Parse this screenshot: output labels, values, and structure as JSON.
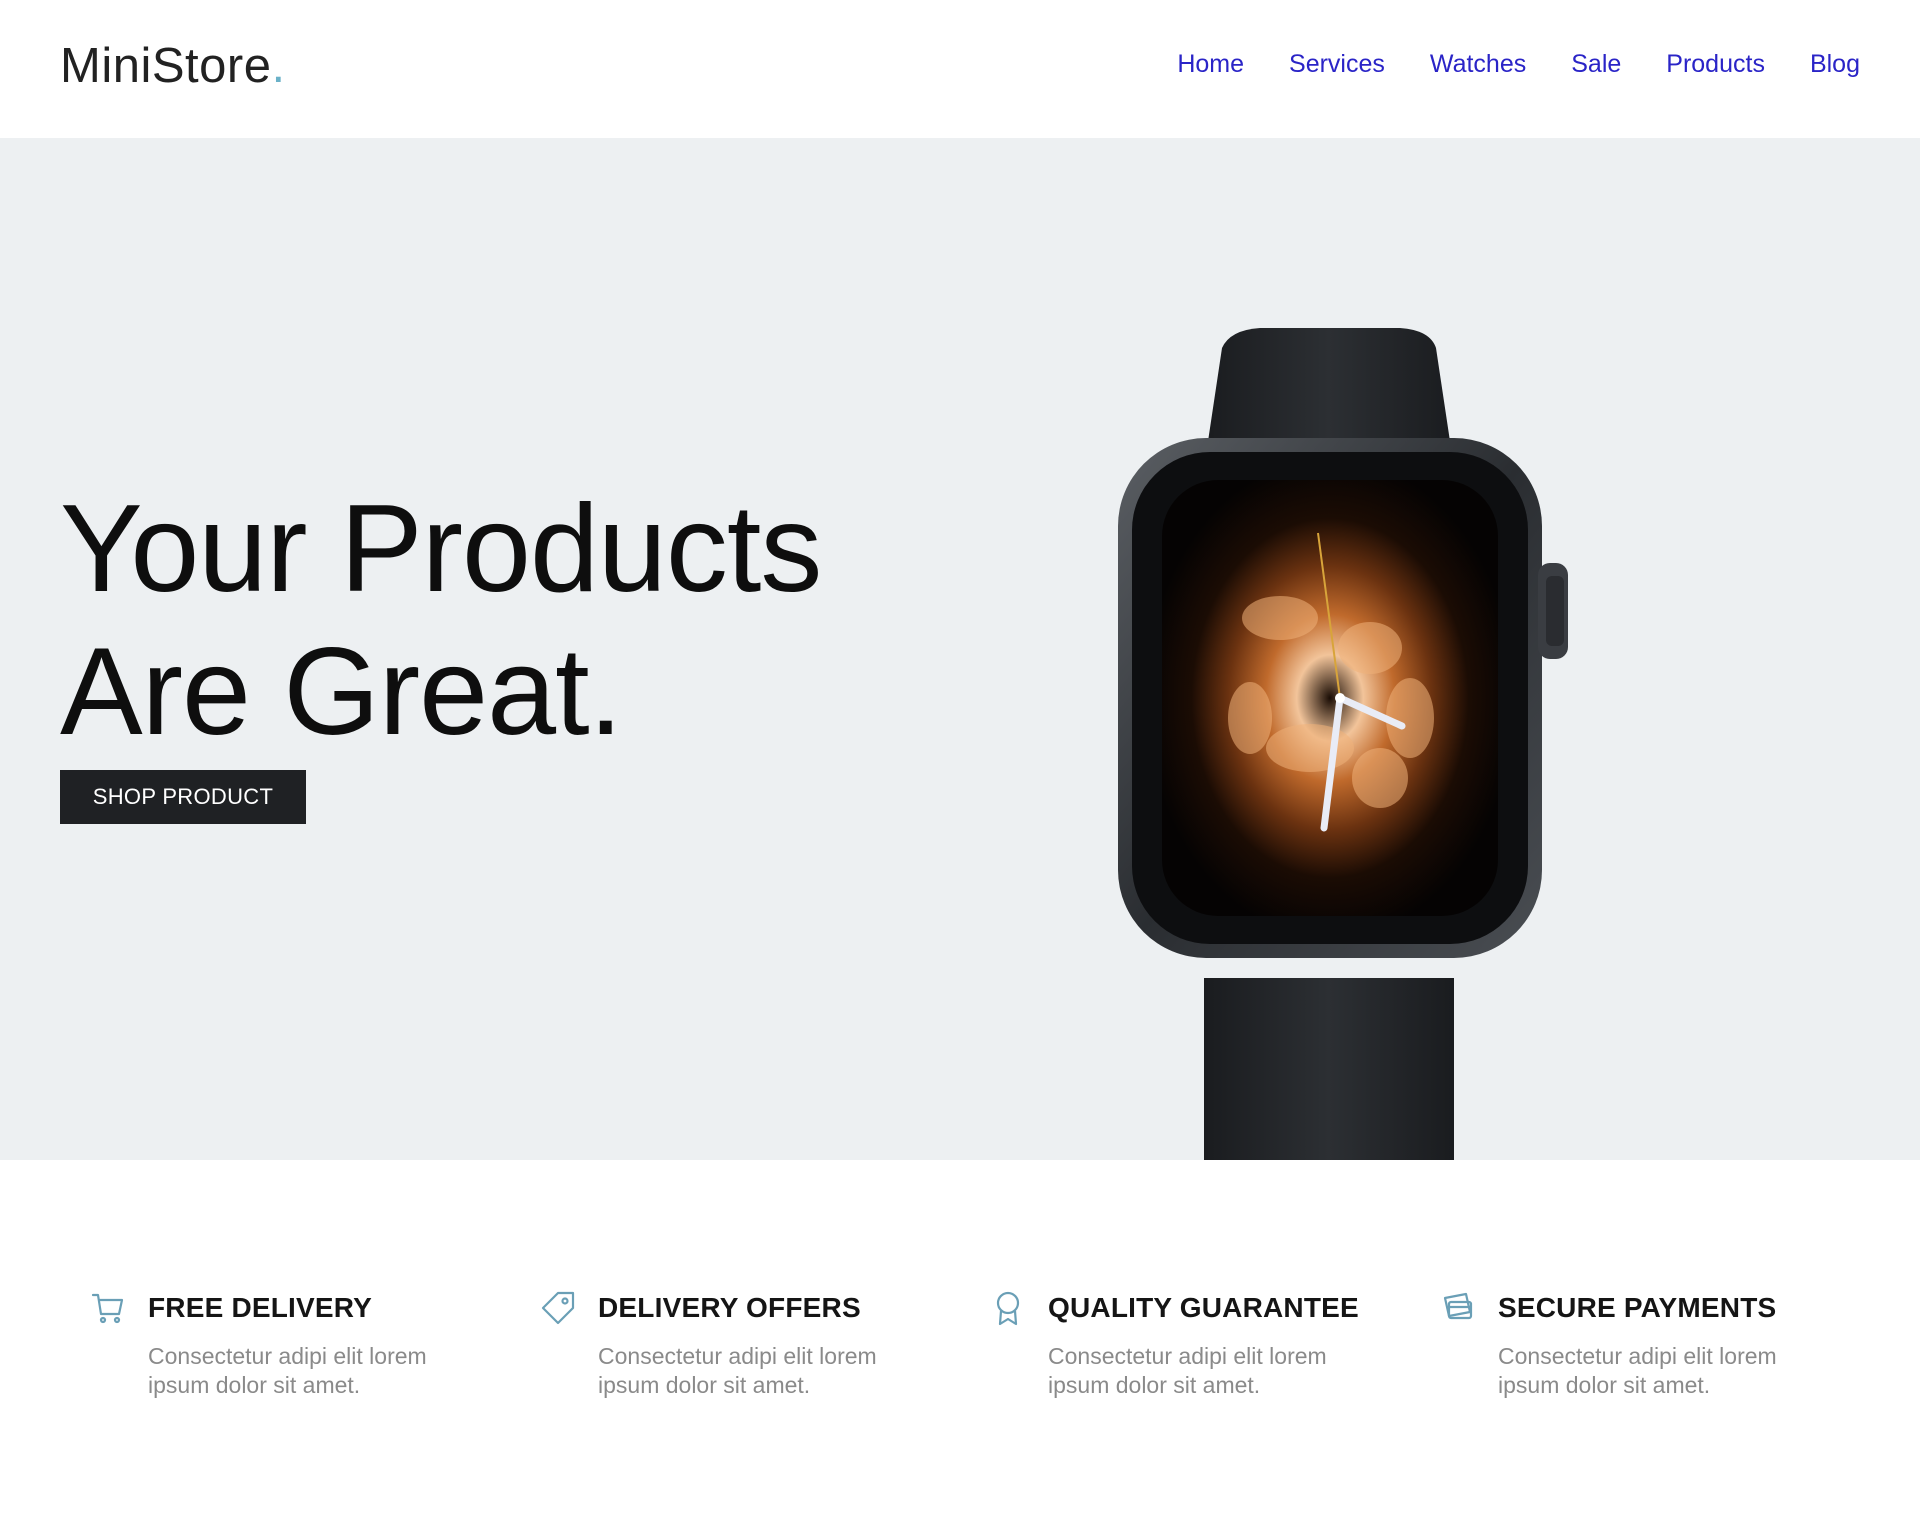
{
  "header": {
    "logo_text": "MiniStore",
    "logo_dot": ".",
    "nav": [
      "Home",
      "Services",
      "Watches",
      "Sale",
      "Products",
      "Blog"
    ]
  },
  "hero": {
    "title_line1": "Your Products",
    "title_line2": "Are Great.",
    "cta_label": "SHOP PRODUCT"
  },
  "features": [
    {
      "icon": "cart-icon",
      "title": "FREE DELIVERY",
      "text": "Consectetur adipi elit lorem ipsum dolor sit amet."
    },
    {
      "icon": "tag-icon",
      "title": "DELIVERY OFFERS",
      "text": "Consectetur adipi elit lorem ipsum dolor sit amet."
    },
    {
      "icon": "award-icon",
      "title": "QUALITY GUARANTEE",
      "text": "Consectetur adipi elit lorem ipsum dolor sit amet."
    },
    {
      "icon": "card-icon",
      "title": "SECURE PAYMENTS",
      "text": "Consectetur adipi elit lorem ipsum dolor sit amet."
    }
  ],
  "colors": {
    "nav_link": "#2a24c7",
    "accent": "#6ab1c8",
    "hero_bg": "#edf0f2",
    "button_bg": "#1f2124"
  }
}
